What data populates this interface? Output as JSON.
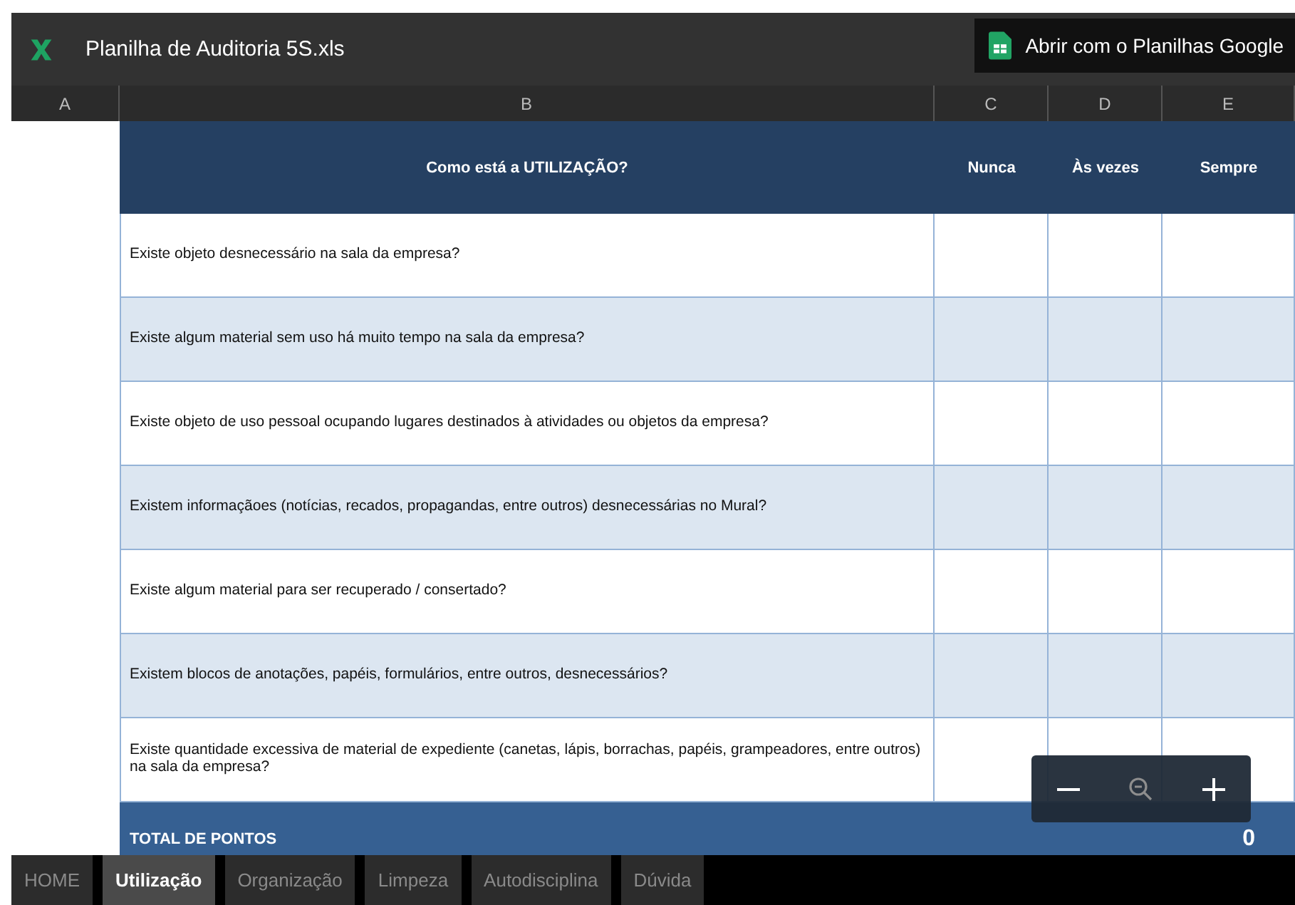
{
  "title_bar": {
    "file_name": "Planilha de Auditoria 5S.xls",
    "open_button": "Abrir com o Planilhas Google"
  },
  "column_headers": [
    "A",
    "B",
    "C",
    "D",
    "E"
  ],
  "table": {
    "heading": "Como está a UTILIZAÇÃO?",
    "options": [
      "Nunca",
      "Às vezes",
      "Sempre"
    ],
    "rows": [
      {
        "question": "Existe objeto desnecessário na sala da empresa?"
      },
      {
        "question": "Existe algum material sem uso há muito tempo na sala da empresa?"
      },
      {
        "question": "Existe objeto de uso pessoal ocupando lugares destinados à atividades ou objetos da empresa?"
      },
      {
        "question": "Existem informaçãoes (notícias, recados, propagandas, entre outros) desnecessárias no Mural?"
      },
      {
        "question": "Existe algum material para ser recuperado / consertado?"
      },
      {
        "question": "Existem blocos de anotações, papéis, formulários, entre outros, desnecessários?"
      },
      {
        "question": "Existe quantidade excessiva de material de expediente (canetas, lápis, borrachas, papéis, grampeadores, entre outros) na sala da empresa?"
      }
    ],
    "total_label": "TOTAL DE PONTOS",
    "total_value": "0"
  },
  "sheet_tabs": [
    {
      "label": "HOME",
      "selected": false
    },
    {
      "label": "Utilização",
      "selected": true
    },
    {
      "label": "Organização",
      "selected": false
    },
    {
      "label": "Limpeza",
      "selected": false
    },
    {
      "label": "Autodisciplina",
      "selected": false
    },
    {
      "label": "Dúvida",
      "selected": false
    }
  ]
}
